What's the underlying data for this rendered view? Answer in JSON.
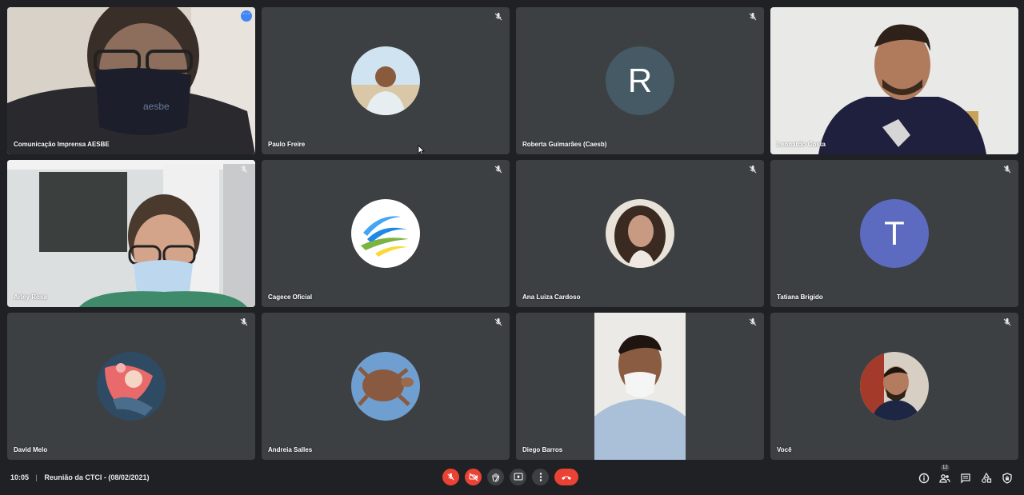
{
  "participants": [
    {
      "name": "Comunicação Imprensa AESBE"
    },
    {
      "name": "Paulo Freire"
    },
    {
      "name": "Roberta Guimarães (Caesb)",
      "initial": "R",
      "color": "#455a64"
    },
    {
      "name": "Leonardo Costa"
    },
    {
      "name": "Arley Rosa"
    },
    {
      "name": "Cagece Oficial"
    },
    {
      "name": "Ana Luiza Cardoso"
    },
    {
      "name": "Tatiana Brigido",
      "initial": "T",
      "color": "#5c6bc0"
    },
    {
      "name": "David Melo"
    },
    {
      "name": "Andreia Salles"
    },
    {
      "name": "Diego Barros"
    },
    {
      "name": "Você"
    }
  ],
  "meeting": {
    "time": "10:05",
    "separator": "|",
    "title": "Reunião da CTCI - (08/02/2021)"
  },
  "people_count": "12",
  "colors": {
    "background": "#202124",
    "tile": "#3c4043",
    "active_border": "#8ab4f8",
    "danger": "#ea4335"
  }
}
